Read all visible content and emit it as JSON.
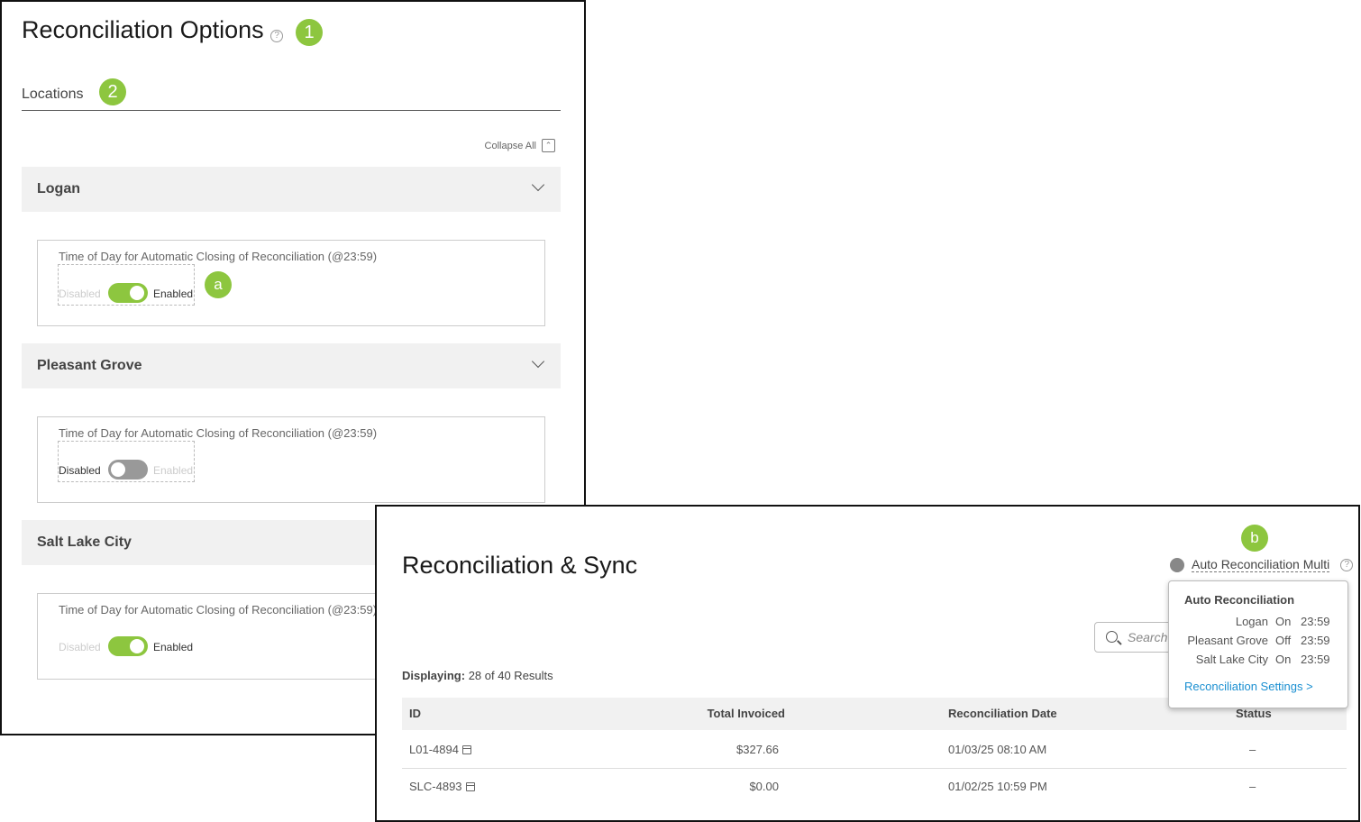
{
  "options": {
    "title": "Reconciliation Options",
    "help": "?",
    "badge1": "1",
    "tab_label": "Locations",
    "badge2": "2",
    "collapse_all": "Collapse All",
    "collapse_glyph": "⌃",
    "badge_a": "a",
    "card_label": "Time of Day for Automatic Closing of Reconciliation (@23:59)",
    "disabled_label": "Disabled",
    "enabled_label": "Enabled",
    "locations": [
      {
        "name": "Logan",
        "enabled": true
      },
      {
        "name": "Pleasant Grove",
        "enabled": false
      },
      {
        "name": "Salt Lake City",
        "enabled": true
      }
    ]
  },
  "sync": {
    "title": "Reconciliation & Sync",
    "badge_b": "b",
    "auto_label": "Auto Reconciliation Multi",
    "help": "?",
    "search_placeholder": "Search",
    "displaying_label": "Displaying:",
    "displaying_value": "28 of 40 Results",
    "columns": [
      "ID",
      "Total Invoiced",
      "Reconciliation Date",
      "Status"
    ],
    "rows": [
      {
        "id": "L01-4894",
        "total": "$327.66",
        "date": "01/03/25 08:10 AM",
        "status": "–"
      },
      {
        "id": "SLC-4893",
        "total": "$0.00",
        "date": "01/02/25 10:59 PM",
        "status": "–"
      }
    ],
    "popover": {
      "title": "Auto Reconciliation",
      "rows": [
        {
          "location": "Logan",
          "state": "On",
          "time": "23:59"
        },
        {
          "location": "Pleasant Grove",
          "state": "Off",
          "time": "23:59"
        },
        {
          "location": "Salt Lake City",
          "state": "On",
          "time": "23:59"
        }
      ],
      "link": "Reconciliation Settings >"
    }
  },
  "colors": {
    "accent_green": "#8dc63f",
    "link_blue": "#1a8fd1",
    "status_dot": "#888888"
  }
}
